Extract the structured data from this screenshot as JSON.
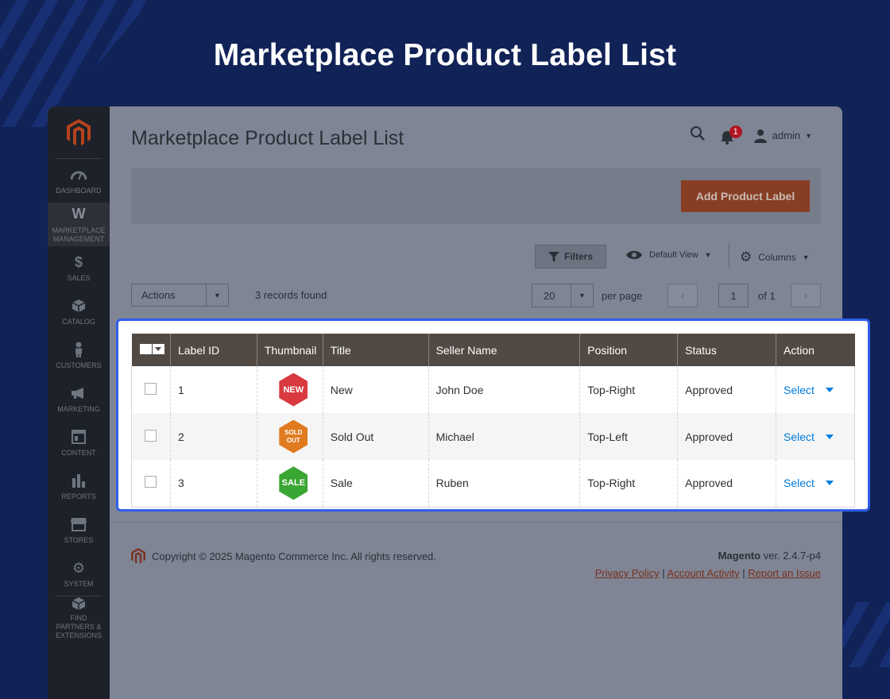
{
  "banner": {
    "title": "Marketplace Product Label List"
  },
  "sidebar": {
    "items": [
      {
        "label": "DASHBOARD",
        "icon": "dashboard-icon"
      },
      {
        "label": "MARKETPLACE MANAGEMENT",
        "icon": "marketplace-icon",
        "active": true
      },
      {
        "label": "SALES",
        "icon": "dollar-icon"
      },
      {
        "label": "CATALOG",
        "icon": "cube-icon"
      },
      {
        "label": "CUSTOMERS",
        "icon": "person-icon"
      },
      {
        "label": "MARKETING",
        "icon": "megaphone-icon"
      },
      {
        "label": "CONTENT",
        "icon": "layout-icon"
      },
      {
        "label": "REPORTS",
        "icon": "bar-chart-icon"
      },
      {
        "label": "STORES",
        "icon": "store-icon"
      },
      {
        "label": "SYSTEM",
        "icon": "gear-icon"
      },
      {
        "label": "FIND PARTNERS & EXTENSIONS",
        "icon": "box-icon"
      }
    ]
  },
  "header": {
    "title": "Marketplace Product Label List",
    "notifications": "1",
    "user": "admin"
  },
  "action_bar": {
    "add_label": "Add Product Label"
  },
  "toolbar": {
    "filters": "Filters",
    "default_view": "Default View",
    "columns": "Columns",
    "actions": "Actions",
    "records": "3 records found",
    "per_page_value": "20",
    "per_page_label": "per page",
    "page": "1",
    "of": "of 1"
  },
  "table": {
    "headers": [
      "Label ID",
      "Thumbnail",
      "Title",
      "Seller Name",
      "Position",
      "Status",
      "Action"
    ],
    "rows": [
      {
        "id": "1",
        "thumb_text": "NEW",
        "thumb_color": "#d83a3f",
        "title": "New",
        "seller": "John Doe",
        "position": "Top-Right",
        "status": "Approved",
        "action": "Select"
      },
      {
        "id": "2",
        "thumb_text_1": "SOLD",
        "thumb_text_2": "OUT",
        "thumb_color": "#e07b1f",
        "title": "Sold Out",
        "seller": "Michael",
        "position": "Top-Left",
        "status": "Approved",
        "action": "Select"
      },
      {
        "id": "3",
        "thumb_text": "SALE",
        "thumb_color": "#3aa633",
        "title": "Sale",
        "seller": "Ruben",
        "position": "Top-Right",
        "status": "Approved",
        "action": "Select"
      }
    ]
  },
  "footer": {
    "copyright": "Copyright © 2025 Magento Commerce Inc. All rights reserved.",
    "brand": "Magento",
    "version": "ver. 2.4.7-p4",
    "links": [
      "Privacy Policy",
      "Account Activity",
      "Report an Issue"
    ],
    "separator": "|"
  },
  "colors": {
    "background": "#112257",
    "accent": "#2f5fe8",
    "button": "#eb5202",
    "link": "#007bdb"
  }
}
